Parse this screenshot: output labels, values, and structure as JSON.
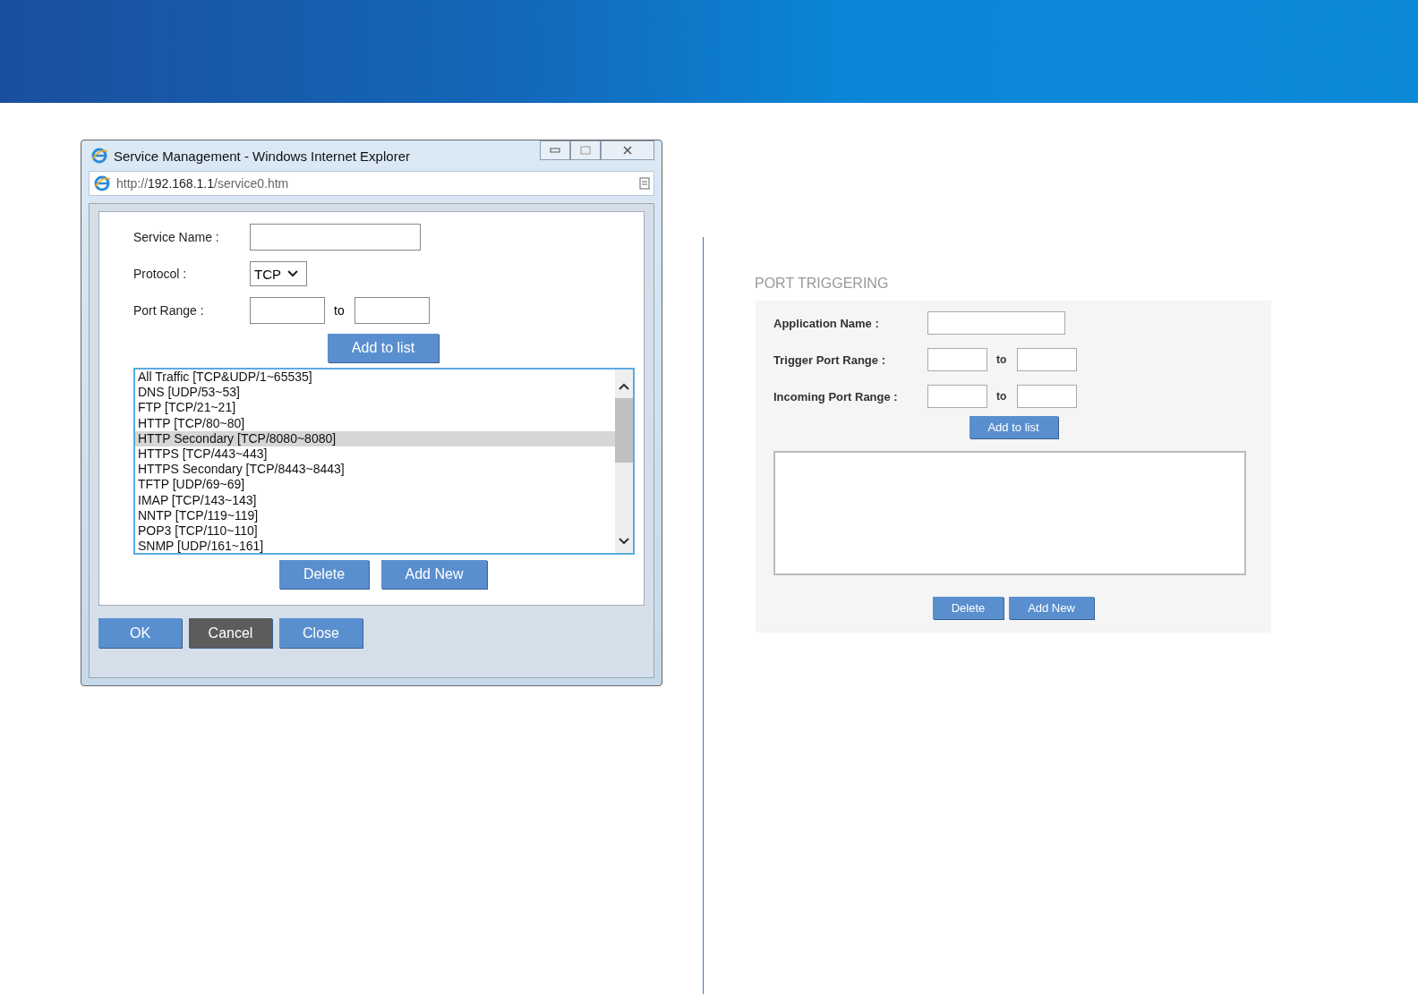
{
  "dialog": {
    "title": "Service Management - Windows Internet Explorer",
    "address": {
      "prefix": "http://",
      "host": "192.168.1.1",
      "path": "/service0.htm"
    },
    "fields": [
      {
        "kind": "text",
        "label": "Service Name :"
      },
      {
        "kind": "select",
        "label": "Protocol :",
        "value": "TCP"
      },
      {
        "kind": "range",
        "label": "Port Range :",
        "separator": "to"
      }
    ],
    "add_button": "Add to list",
    "services": [
      {
        "label": "All Traffic [TCP&UDP/1~65535]",
        "selected": false
      },
      {
        "label": "DNS [UDP/53~53]",
        "selected": false
      },
      {
        "label": "FTP [TCP/21~21]",
        "selected": false
      },
      {
        "label": "HTTP [TCP/80~80]",
        "selected": false
      },
      {
        "label": "HTTP Secondary [TCP/8080~8080]",
        "selected": true
      },
      {
        "label": "HTTPS [TCP/443~443]",
        "selected": false
      },
      {
        "label": "HTTPS Secondary [TCP/8443~8443]",
        "selected": false
      },
      {
        "label": "TFTP [UDP/69~69]",
        "selected": false
      },
      {
        "label": "IMAP [TCP/143~143]",
        "selected": false
      },
      {
        "label": "NNTP [TCP/119~119]",
        "selected": false
      },
      {
        "label": "POP3 [TCP/110~110]",
        "selected": false
      },
      {
        "label": "SNMP [UDP/161~161]",
        "selected": false
      }
    ],
    "list_buttons": [
      "Delete",
      "Add New"
    ],
    "footer_buttons": [
      {
        "label": "OK",
        "kind": "primary"
      },
      {
        "label": "Cancel",
        "kind": "dark"
      },
      {
        "label": "Close",
        "kind": "primary"
      }
    ]
  },
  "port_triggering": {
    "title": "PORT TRIGGERING",
    "fields": [
      {
        "kind": "text",
        "label": "Application Name :"
      },
      {
        "kind": "range",
        "label": "Trigger Port Range :",
        "separator": "to"
      },
      {
        "kind": "range",
        "label": "Incoming Port Range :",
        "separator": "to"
      }
    ],
    "add_button": "Add to list",
    "list_buttons": [
      "Delete",
      "Add New"
    ]
  }
}
